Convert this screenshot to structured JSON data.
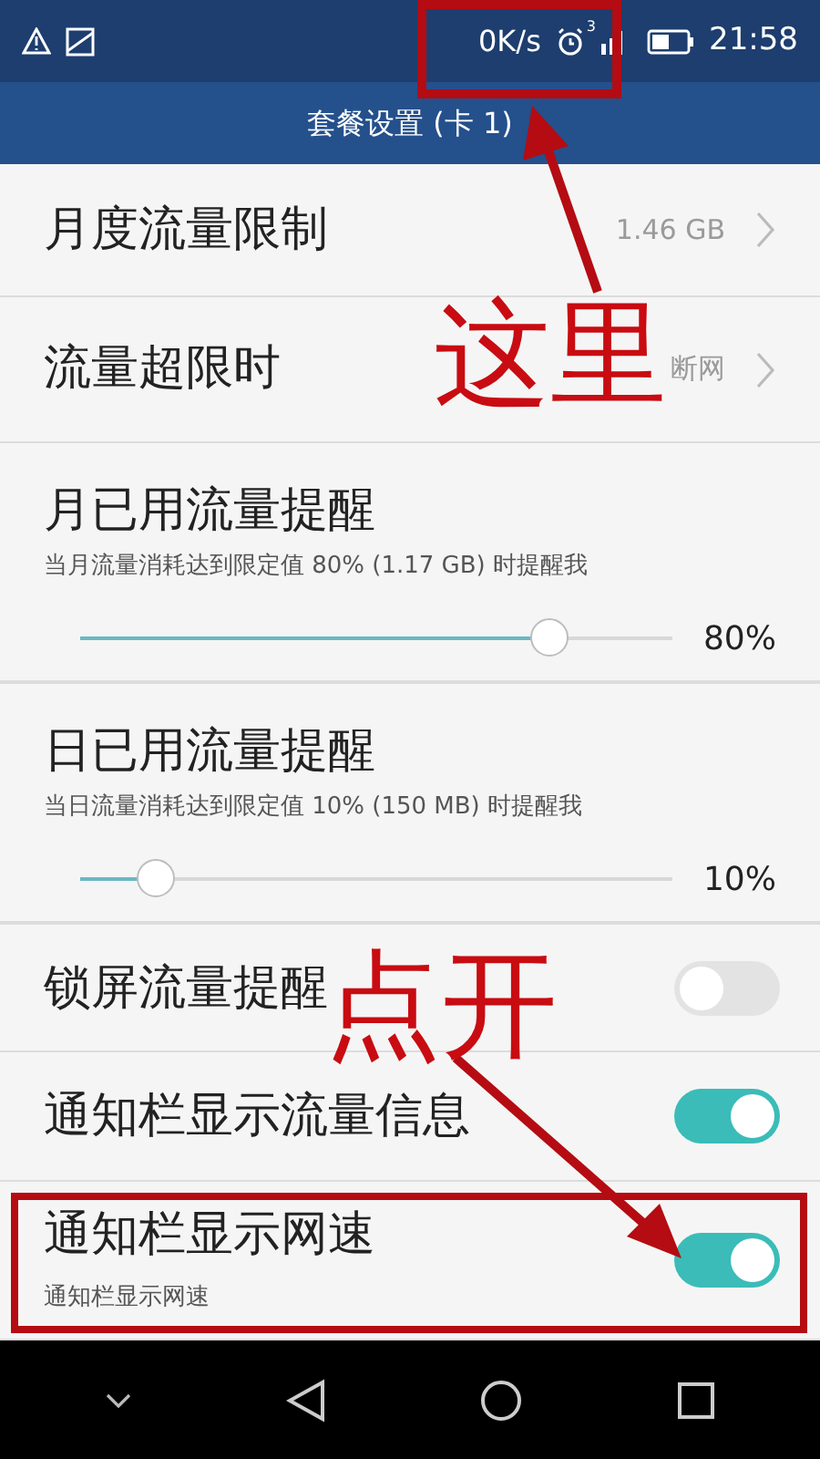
{
  "status_bar": {
    "speed": "0K/s",
    "sim": "3",
    "time": "21:58"
  },
  "header": {
    "title": "套餐设置 (卡 1)"
  },
  "settings": [
    {
      "kind": "link",
      "label": "月度流量限制",
      "value": "1.46 GB"
    },
    {
      "kind": "link",
      "label": "流量超限时",
      "value": "断网"
    },
    {
      "kind": "slider",
      "label": "月已用流量提醒",
      "description": "当月流量消耗达到限定值 80% (1.17 GB) 时提醒我",
      "level": 0.8,
      "reading": "80%"
    },
    {
      "kind": "slider",
      "label": "日已用流量提醒",
      "description": "当日流量消耗达到限定值 10% (150 MB) 时提醒我",
      "level": 0.1,
      "reading": "10%"
    },
    {
      "kind": "switch",
      "label": "锁屏流量提醒",
      "on": false,
      "highlighted": false
    },
    {
      "kind": "switch",
      "label": "通知栏显示流量信息",
      "on": true,
      "highlighted": false
    },
    {
      "kind": "switch",
      "label": "通知栏显示网速",
      "description": "通知栏显示网速",
      "on": true,
      "highlighted": true
    }
  ],
  "annotations": [
    "这里",
    "点开"
  ]
}
